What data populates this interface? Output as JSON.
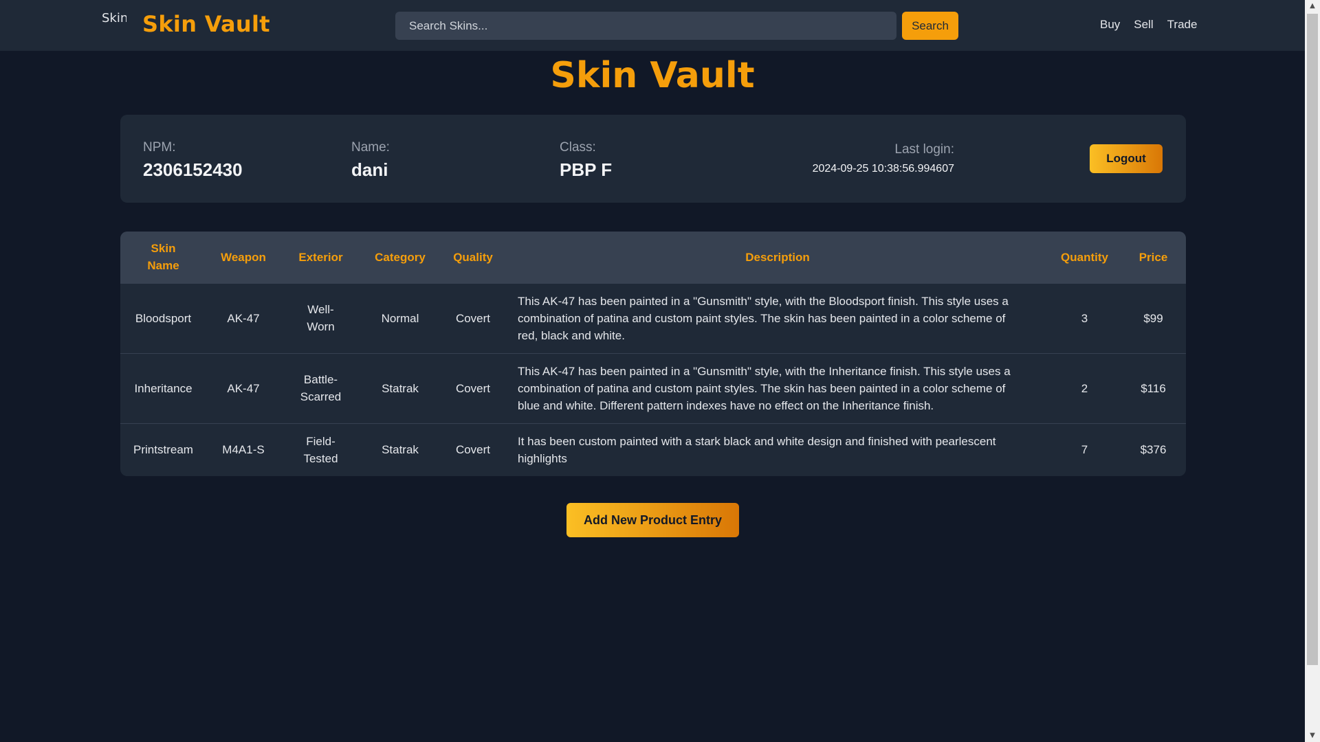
{
  "navbar": {
    "logo_alt": "Skin",
    "brand": "Skin Vault",
    "search_placeholder": "Search Skins...",
    "search_label": "Search",
    "links": [
      "Buy",
      "Sell",
      "Trade"
    ]
  },
  "page_title": "Skin Vault",
  "user_info": {
    "npm_label": "NPM:",
    "npm_value": "2306152430",
    "name_label": "Name:",
    "name_value": "dani",
    "class_label": "Class:",
    "class_value": "PBP F",
    "last_login_label": "Last login:",
    "last_login_value": "2024-09-25 10:38:56.994607",
    "logout_label": "Logout"
  },
  "table": {
    "headers": [
      "Skin Name",
      "Weapon",
      "Exterior",
      "Category",
      "Quality",
      "Description",
      "Quantity",
      "Price"
    ],
    "rows": [
      {
        "skin_name": "Bloodsport",
        "weapon": "AK-47",
        "exterior": "Well-Worn",
        "category": "Normal",
        "quality": "Covert",
        "description": "This AK-47 has been painted in a \"Gunsmith\" style, with the Bloodsport finish. This style uses a combination of patina and custom paint styles. The skin has been painted in a color scheme of red, black and white.",
        "quantity": "3",
        "price": "$99"
      },
      {
        "skin_name": "Inheritance",
        "weapon": "AK-47",
        "exterior": "Battle-Scarred",
        "category": "Statrak",
        "quality": "Covert",
        "description": "This AK-47 has been painted in a \"Gunsmith\" style, with the Inheritance finish. This style uses a combination of patina and custom paint styles. The skin has been painted in a color scheme of blue and white. Different pattern indexes have no effect on the Inheritance finish.",
        "quantity": "2",
        "price": "$116"
      },
      {
        "skin_name": "Printstream",
        "weapon": "M4A1-S",
        "exterior": "Field-Tested",
        "category": "Statrak",
        "quality": "Covert",
        "description": "It has been custom painted with a stark black and white design and finished with pearlescent highlights",
        "quantity": "7",
        "price": "$376"
      }
    ]
  },
  "add_button_label": "Add New Product Entry",
  "colors": {
    "accent": "#f59e0b",
    "background": "#111827",
    "panel": "#1f2937",
    "header_row": "#374151"
  }
}
